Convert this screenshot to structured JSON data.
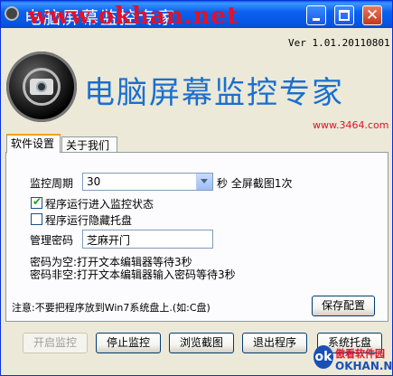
{
  "window": {
    "title": "电脑屏幕监控专家",
    "watermark": "www.okhan.net",
    "close_glyph": "✕"
  },
  "header": {
    "version": "Ver 1.01.20110801",
    "app_name": "电脑屏幕监控专家",
    "site": "www.3464.com"
  },
  "tabs": [
    {
      "label": "软件设置",
      "active": true
    },
    {
      "label": "关于我们",
      "active": false
    }
  ],
  "settings": {
    "period_label": "监控周期",
    "period_value": "30",
    "period_suffix": "秒 全屏截图1次",
    "enter_monitor_label": "程序运行进入监控状态",
    "enter_monitor_checked": true,
    "hide_tray_label": "程序运行隐藏托盘",
    "hide_tray_checked": false,
    "password_label": "管理密码",
    "password_value": "芝麻开门",
    "note_empty": "密码为空:打开文本编辑器等待3秒",
    "note_nonempty": "密码非空:打开文本编辑器输入密码等待3秒",
    "warning": "注意:不要把程序放到Win7系统盘上.(如:C盘)",
    "save_label": "保存配置"
  },
  "buttons": {
    "start": "开启监控",
    "stop": "停止监控",
    "browse": "浏览截图",
    "exit": "退出程序",
    "tray": "系统托盘"
  },
  "corner_logo": {
    "mark": "ok",
    "cn": "傲看软件园",
    "en": "OKHAN.NET"
  },
  "colors": {
    "titlebar": "#0a5ee8",
    "app_name": "#1a6fd0",
    "watermark": "#e0112a",
    "checkmark": "#21a121"
  }
}
